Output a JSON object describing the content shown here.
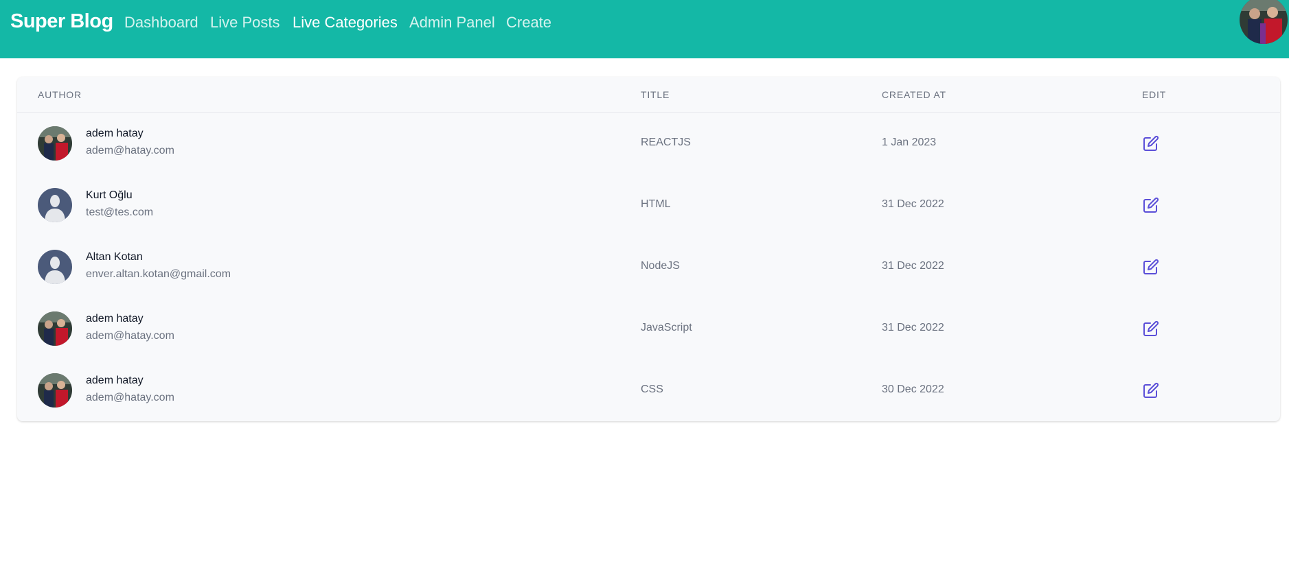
{
  "navbar": {
    "brand": "Super Blog",
    "links": [
      {
        "label": "Dashboard",
        "active": false
      },
      {
        "label": "Live Posts",
        "active": false
      },
      {
        "label": "Live Categories",
        "active": true
      },
      {
        "label": "Admin Panel",
        "active": false
      },
      {
        "label": "Create",
        "active": false
      }
    ],
    "avatar_icon": "user-photo-avatar"
  },
  "table": {
    "headers": {
      "author": "AUTHOR",
      "title": "TITLE",
      "created_at": "CREATED AT",
      "edit": "EDIT"
    },
    "rows": [
      {
        "name": "adem hatay",
        "email": "adem@hatay.com",
        "title": "REACTJS",
        "created_at": "1 Jan 2023",
        "avatar": "photo",
        "edit_icon": "edit-icon"
      },
      {
        "name": "Kurt Oğlu",
        "email": "test@tes.com",
        "title": "HTML",
        "created_at": "31 Dec 2022",
        "avatar": "default",
        "edit_icon": "edit-icon"
      },
      {
        "name": "Altan Kotan",
        "email": "enver.altan.kotan@gmail.com",
        "title": "NodeJS",
        "created_at": "31 Dec 2022",
        "avatar": "default",
        "edit_icon": "edit-icon"
      },
      {
        "name": "adem hatay",
        "email": "adem@hatay.com",
        "title": "JavaScript",
        "created_at": "31 Dec 2022",
        "avatar": "photo",
        "edit_icon": "edit-icon"
      },
      {
        "name": "adem hatay",
        "email": "adem@hatay.com",
        "title": "CSS",
        "created_at": "30 Dec 2022",
        "avatar": "photo",
        "edit_icon": "edit-icon"
      }
    ]
  },
  "colors": {
    "navbar_bg": "#14b8a6",
    "edit_icon": "#5b4fd8",
    "default_avatar": "#4b5a7a"
  }
}
